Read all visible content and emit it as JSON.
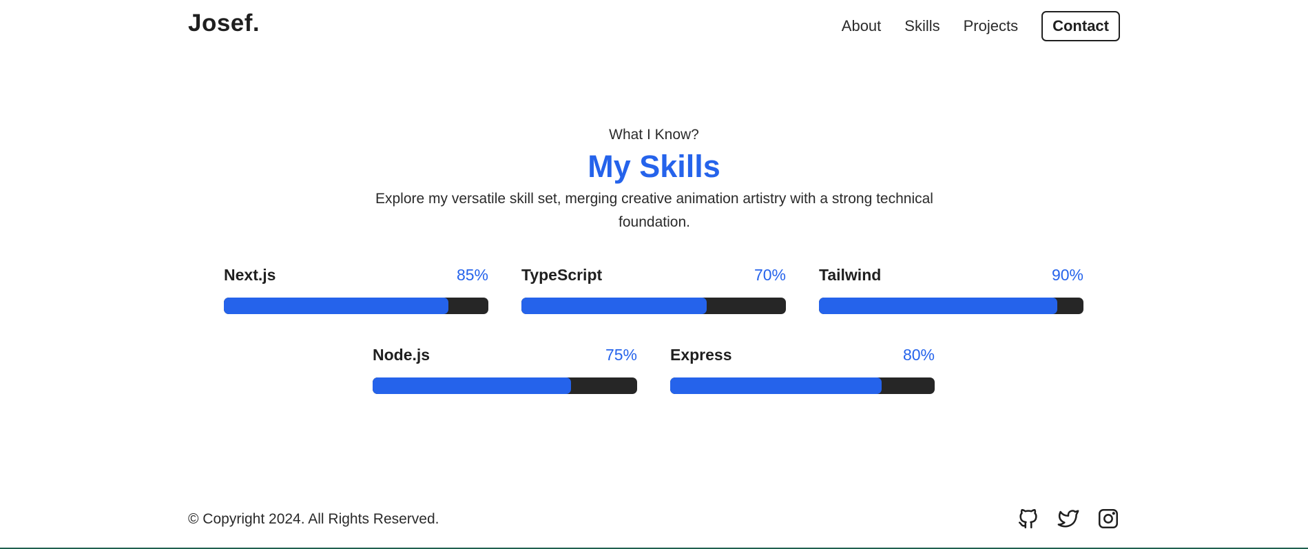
{
  "header": {
    "logo": "Josef.",
    "nav": [
      {
        "label": "About"
      },
      {
        "label": "Skills"
      },
      {
        "label": "Projects"
      }
    ],
    "contact_label": "Contact"
  },
  "skills_section": {
    "subtitle": "What I Know?",
    "title": "My Skills",
    "description": "Explore my versatile skill set, merging creative animation artistry with a strong technical foundation.",
    "skills": [
      {
        "name": "Next.js",
        "percent_label": "85%",
        "level": 85
      },
      {
        "name": "TypeScript",
        "percent_label": "70%",
        "level": 70
      },
      {
        "name": "Tailwind",
        "percent_label": "90%",
        "level": 90
      },
      {
        "name": "Node.js",
        "percent_label": "75%",
        "level": 75
      },
      {
        "name": "Express",
        "percent_label": "80%",
        "level": 80
      }
    ]
  },
  "footer": {
    "copyright": "© Copyright 2024. All Rights Reserved.",
    "social_icons": [
      "github-icon",
      "twitter-icon",
      "instagram-icon"
    ]
  },
  "colors": {
    "accent": "#2563eb",
    "bar_track": "#262626",
    "text": "#222222"
  }
}
